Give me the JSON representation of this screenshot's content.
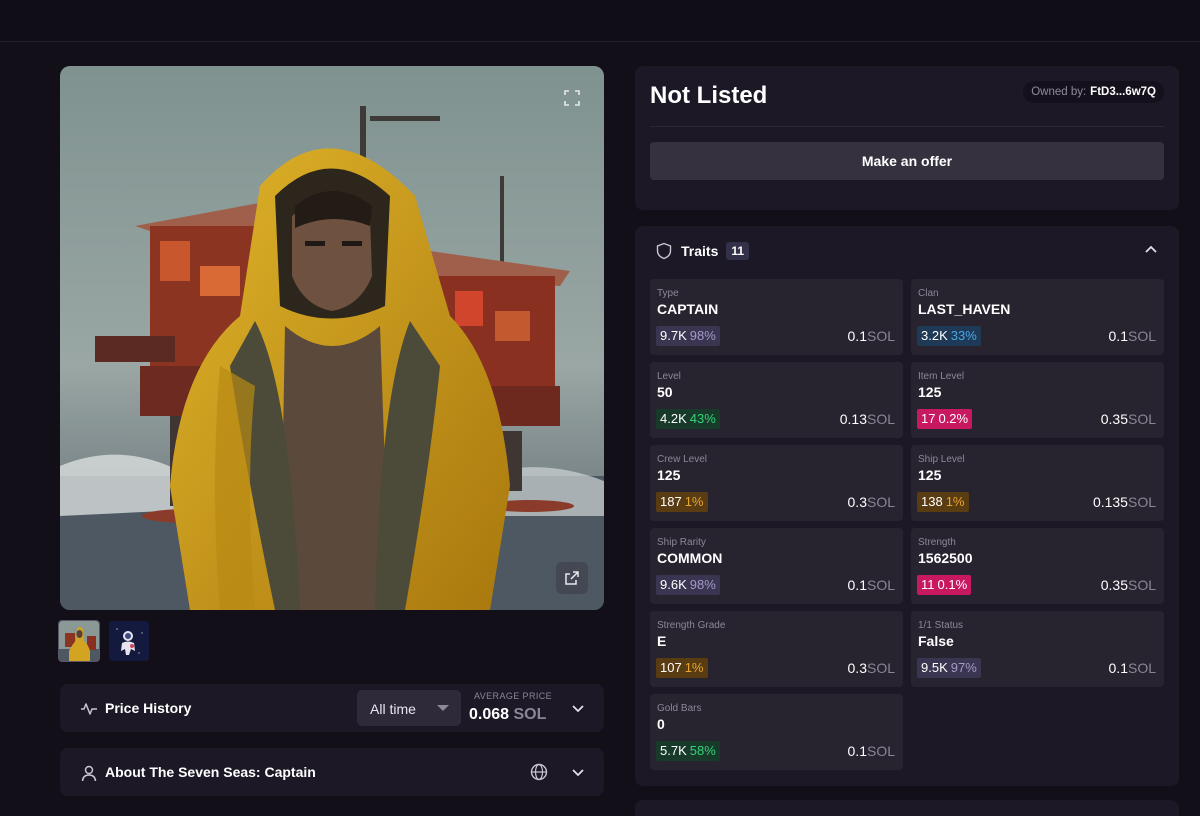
{
  "listing": {
    "status": "Not Listed",
    "owner_label": "Owned by:",
    "owner_address": "FtD3...6w7Q",
    "offer_button": "Make an offer"
  },
  "media": {
    "subject": "Captain in yellow raincoat in front of oil rig",
    "expand_icon": "expand-icon",
    "external_icon": "external-link-icon",
    "thumbnails": [
      {
        "name": "thumbnail-captain",
        "active": true
      },
      {
        "name": "thumbnail-astronaut",
        "active": false
      }
    ]
  },
  "price_history": {
    "title": "Price History",
    "range": "All time",
    "avg_label": "AVERAGE PRICE",
    "avg_value": "0.068",
    "avg_unit": "SOL"
  },
  "about": {
    "title": "About The Seven Seas: Captain"
  },
  "traits": {
    "title": "Traits",
    "count": "11",
    "items": [
      {
        "name": "Type",
        "value": "CAPTAIN",
        "count": "9.7K",
        "pct": "98%",
        "price": "0.1",
        "unit": "SOL",
        "color": "#a89ac9",
        "bg": "#3a3550"
      },
      {
        "name": "Clan",
        "value": "LAST_HAVEN",
        "count": "3.2K",
        "pct": "33%",
        "price": "0.1",
        "unit": "SOL",
        "color": "#4aa6e8",
        "bg": "#1f3a56"
      },
      {
        "name": "Level",
        "value": "50",
        "count": "4.2K",
        "pct": "43%",
        "price": "0.13",
        "unit": "SOL",
        "color": "#36d27a",
        "bg": "#173a2a"
      },
      {
        "name": "Item Level",
        "value": "125",
        "count": "17",
        "pct": "0.2%",
        "price": "0.35",
        "unit": "SOL",
        "color": "#ffffff",
        "bg": "#c8185f"
      },
      {
        "name": "Crew Level",
        "value": "125",
        "count": "187",
        "pct": "1%",
        "price": "0.3",
        "unit": "SOL",
        "color": "#e6a532",
        "bg": "#5a3c12"
      },
      {
        "name": "Ship Level",
        "value": "125",
        "count": "138",
        "pct": "1%",
        "price": "0.135",
        "unit": "SOL",
        "color": "#e6a532",
        "bg": "#5a3c12"
      },
      {
        "name": "Ship Rarity",
        "value": "COMMON",
        "count": "9.6K",
        "pct": "98%",
        "price": "0.1",
        "unit": "SOL",
        "color": "#a89ac9",
        "bg": "#3a3550"
      },
      {
        "name": "Strength",
        "value": "1562500",
        "count": "11",
        "pct": "0.1%",
        "price": "0.35",
        "unit": "SOL",
        "color": "#ffffff",
        "bg": "#c8185f"
      },
      {
        "name": "Strength Grade",
        "value": "E",
        "count": "107",
        "pct": "1%",
        "price": "0.3",
        "unit": "SOL",
        "color": "#e6a532",
        "bg": "#5a3c12"
      },
      {
        "name": "1/1 Status",
        "value": "False",
        "count": "9.5K",
        "pct": "97%",
        "price": "0.1",
        "unit": "SOL",
        "color": "#a89ac9",
        "bg": "#3a3550"
      },
      {
        "name": "Gold Bars",
        "value": "0",
        "count": "5.7K",
        "pct": "58%",
        "price": "0.1",
        "unit": "SOL",
        "color": "#36d27a",
        "bg": "#173a2a"
      }
    ]
  }
}
